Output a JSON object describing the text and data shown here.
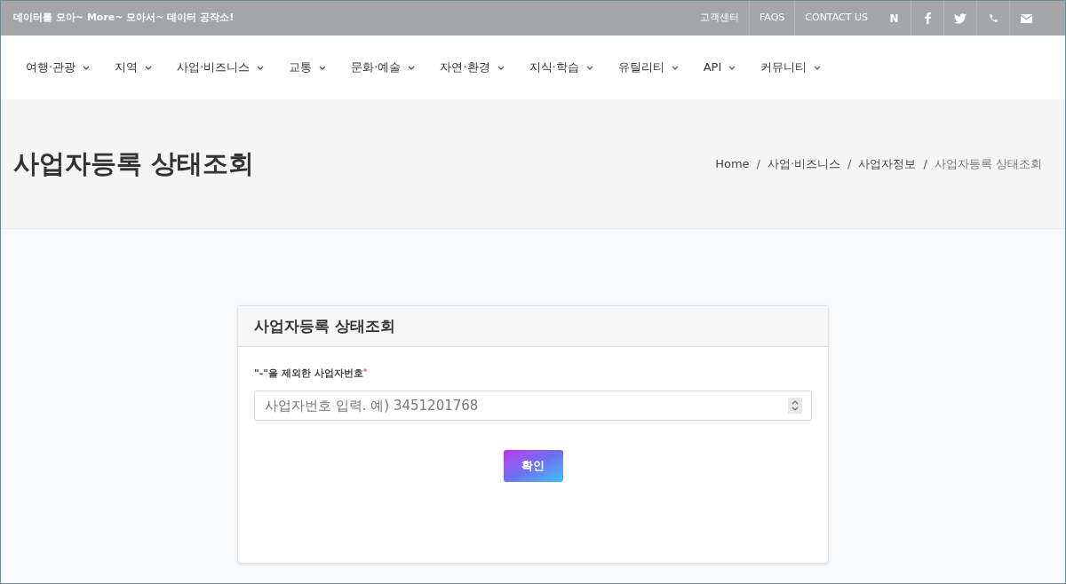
{
  "topbar": {
    "slogan": "데이터를 모아~ More~ 모아서~ 데이터 공작소!",
    "links": [
      "고객센터",
      "FAQS",
      "CONTACT US"
    ],
    "icons": [
      {
        "kind": "naver",
        "text": "N"
      },
      {
        "kind": "facebook"
      },
      {
        "kind": "twitter"
      },
      {
        "kind": "phone"
      },
      {
        "kind": "mail"
      }
    ]
  },
  "nav": [
    "여행·관광",
    "지역",
    "사업·비즈니스",
    "교통",
    "문화·예술",
    "자연·환경",
    "지식·학습",
    "유틸리티",
    "API",
    "커뮤니티"
  ],
  "page_title": "사업자등록 상태조회",
  "breadcrumb": [
    {
      "label": "Home",
      "current": false
    },
    {
      "label": "사업·비즈니스",
      "current": false
    },
    {
      "label": "사업자정보",
      "current": false
    },
    {
      "label": "사업자등록 상태조회",
      "current": true
    }
  ],
  "breadcrumb_separator": "/",
  "card": {
    "title": "사업자등록 상태조회",
    "field_label": "\"-\"을 제외한 사업자번호",
    "required_mark": "*",
    "placeholder": "사업자번호 입력. 예) 3451201768",
    "button": "확인"
  }
}
